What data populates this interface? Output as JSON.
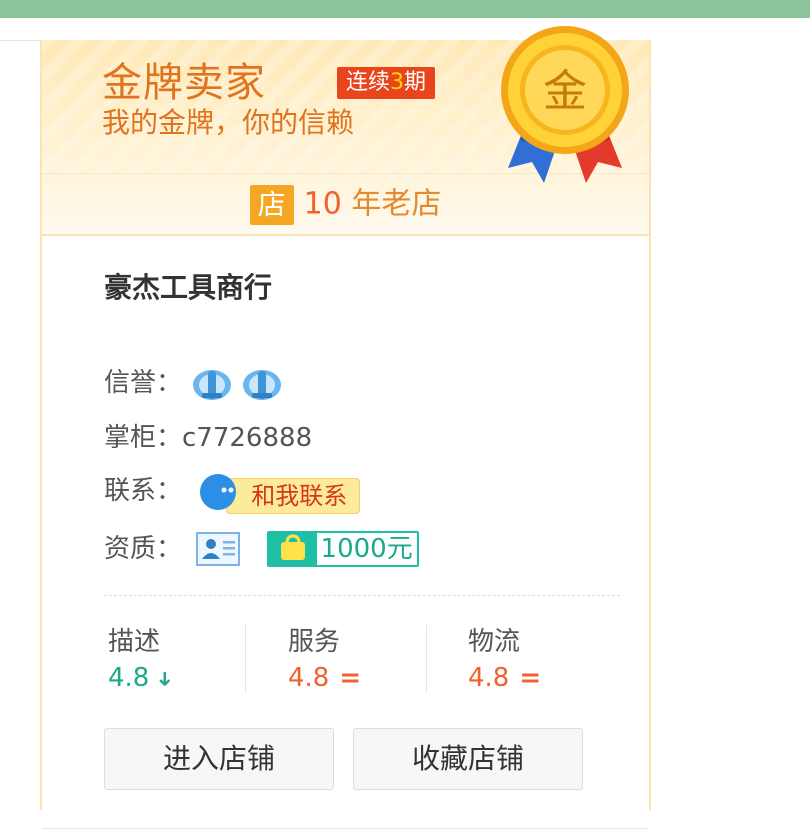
{
  "colors": {
    "brand_orange": "#e0741e",
    "badge_red": "#e9451c",
    "score_green": "#1fa88c",
    "score_red": "#f0622d"
  },
  "header": {
    "title": "金牌卖家",
    "streak_prefix": "连续",
    "streak_number": "3",
    "streak_suffix": "期",
    "slogan": "我的金牌，你的信赖",
    "medal_char": "金",
    "store_icon_char": "店",
    "store_years": "10",
    "store_years_label": " 年老店"
  },
  "shop": {
    "name": "豪杰工具商行",
    "reputation_label": "信誉：",
    "reputation_icons": [
      "crown-icon",
      "crown-icon"
    ],
    "owner_label": "掌柜：",
    "owner_value": "c7726888",
    "contact_label": "联系：",
    "contact_button": "和我联系",
    "qualification_label": "资质：",
    "deposit_amount": "1000元"
  },
  "scores": [
    {
      "label": "描述",
      "value": "4.8",
      "trend": "down",
      "color": "#1fa88c"
    },
    {
      "label": "服务",
      "value": "4.8",
      "trend": "equal",
      "color": "#f0622d"
    },
    {
      "label": "物流",
      "value": "4.8",
      "trend": "equal",
      "color": "#f0622d"
    }
  ],
  "actions": {
    "enter_store": "进入店铺",
    "favorite_store": "收藏店铺"
  }
}
